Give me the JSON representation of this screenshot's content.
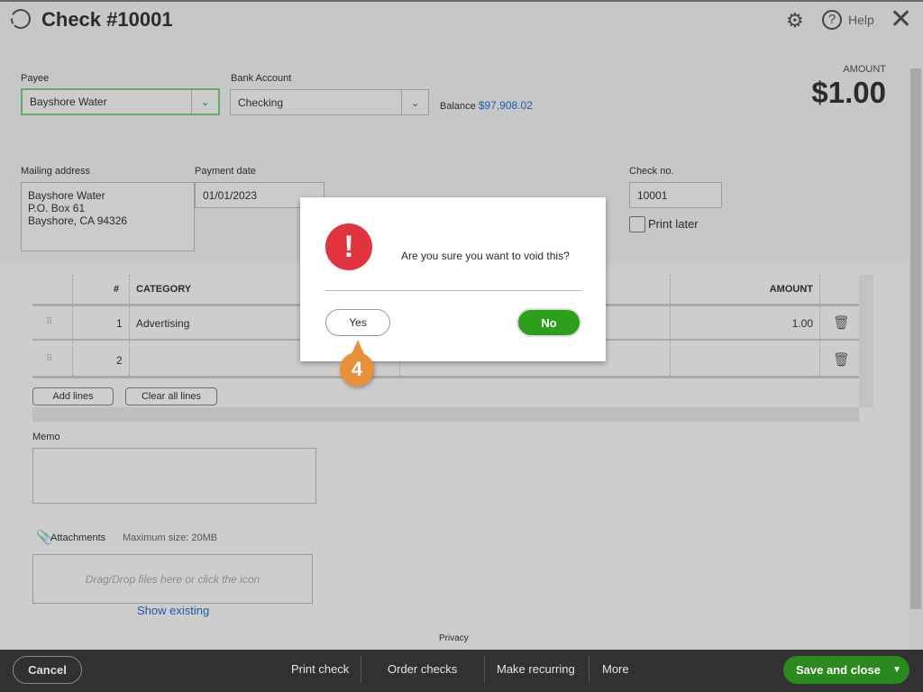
{
  "header": {
    "title": "Check #10001",
    "help_label": "Help",
    "icons": [
      "history-icon",
      "gear-icon",
      "help-icon",
      "close-icon"
    ]
  },
  "form": {
    "payee_label": "Payee",
    "payee_value": "Bayshore Water",
    "bank_label": "Bank Account",
    "bank_value": "Checking",
    "balance_label": "Balance",
    "balance_value": "$97,908.02",
    "amount_label": "AMOUNT",
    "amount_value": "$1.00",
    "mailing_label": "Mailing address",
    "mailing_lines": [
      "Bayshore Water",
      "P.O. Box 61",
      "Bayshore, CA  94326"
    ],
    "date_label": "Payment date",
    "date_value": "01/01/2023",
    "checkno_label": "Check no.",
    "checkno_value": "10001",
    "print_later_label": "Print later",
    "print_later_checked": false
  },
  "table": {
    "headers": {
      "num": "#",
      "category": "CATEGORY",
      "amount": "AMOUNT"
    },
    "rows": [
      {
        "num": "1",
        "category": "Advertising",
        "amount": "1.00"
      },
      {
        "num": "2",
        "category": "",
        "amount": ""
      }
    ],
    "add_lines": "Add lines",
    "clear_lines": "Clear all lines"
  },
  "memo": {
    "label": "Memo",
    "value": ""
  },
  "attachments": {
    "label": "Attachments",
    "max_size": "Maximum size: 20MB",
    "drop_text": "Drag/Drop files here or click the icon",
    "show_existing": "Show existing"
  },
  "privacy": "Privacy",
  "dialog": {
    "message": "Are you sure you want to void this?",
    "yes": "Yes",
    "no": "No",
    "step_badge": "4"
  },
  "footer": {
    "cancel": "Cancel",
    "print_check": "Print check",
    "order_checks": "Order checks",
    "make_recurring": "Make recurring",
    "more": "More",
    "save_close": "Save and close"
  },
  "colors": {
    "accent_green": "#2ca01c",
    "alert_red": "#e2343f",
    "badge_orange": "#e8903a",
    "link_blue": "#1e5ca8"
  }
}
